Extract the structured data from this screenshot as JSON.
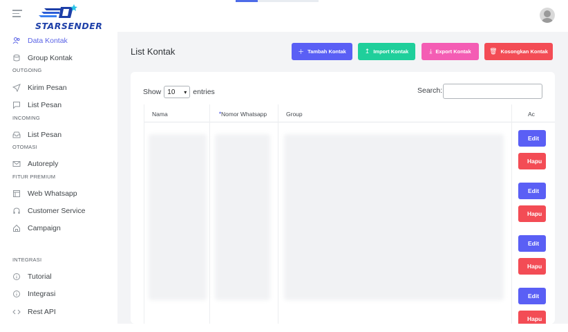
{
  "brand": {
    "logo_text": "STARSENDER"
  },
  "sidebar": {
    "items": [
      {
        "label": "Data Kontak",
        "icon": "users-icon",
        "active": true
      },
      {
        "label": "Group Kontak",
        "icon": "database-icon"
      },
      {
        "label": "Kirim Pesan",
        "icon": "send-icon"
      },
      {
        "label": "List Pesan",
        "icon": "message-icon"
      },
      {
        "label": "List Pesan",
        "icon": "inbox-icon"
      },
      {
        "label": "Autoreply",
        "icon": "mail-icon"
      },
      {
        "label": "Web Whatsapp",
        "icon": "window-icon"
      },
      {
        "label": "Customer Service",
        "icon": "headphones-icon"
      },
      {
        "label": "Campaign",
        "icon": "home-icon"
      },
      {
        "label": "Tutorial",
        "icon": "info-icon"
      },
      {
        "label": "Integrasi",
        "icon": "info-icon"
      },
      {
        "label": "Rest API",
        "icon": "code-icon"
      }
    ],
    "sections": {
      "outgoing": "OUTGOING",
      "incoming": "INCOMING",
      "otomasi": "OTOMASI",
      "fitur_premium": "FITUR PREMIUM",
      "integrasi": "INTEGRASI"
    }
  },
  "main": {
    "title": "List Kontak",
    "buttons": {
      "tambah": "Tambah Kontak",
      "import": "Import Kontak",
      "export": "Export Kontak",
      "kosongkan": "Kosongkan Kontak"
    },
    "table": {
      "show_label": "Show",
      "entries_value": "10",
      "entries_label": "entries",
      "search_label": "Search:",
      "search_value": "",
      "columns": [
        "Nama",
        "Nomor Whatsapp",
        "Group",
        "Ac"
      ],
      "row_actions": {
        "edit": "Edit",
        "hapus": "Hapu"
      }
    }
  },
  "colors": {
    "accent": "#5a5ff5",
    "success": "#1fcf9b",
    "pink": "#f45db4",
    "danger": "#f34c55"
  }
}
